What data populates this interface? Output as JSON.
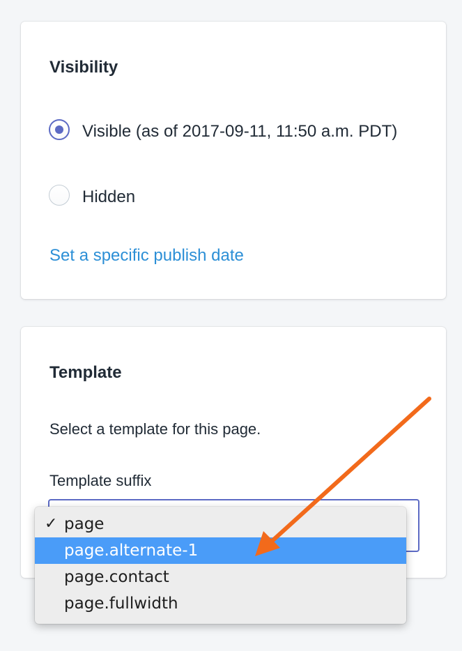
{
  "visibility": {
    "title": "Visibility",
    "options": [
      {
        "label": "Visible (as of 2017-09-11, 11:50 a.m. PDT)",
        "checked": true
      },
      {
        "label": "Hidden",
        "checked": false
      }
    ],
    "publish_link": "Set a specific publish date"
  },
  "template": {
    "title": "Template",
    "help": "Select a template for this page.",
    "suffix_label": "Template suffix",
    "options": [
      {
        "label": "page",
        "selected": true
      },
      {
        "label": "page.alternate-1",
        "highlighted": true
      },
      {
        "label": "page.contact"
      },
      {
        "label": "page.fullwidth"
      }
    ],
    "check_glyph": "✓"
  },
  "colors": {
    "accent": "#5c6ac4",
    "link": "#2c8fd6",
    "highlight": "#4a9cf8",
    "arrow": "#f26a1b"
  },
  "icons": {
    "checkmark": "checkmark-icon",
    "annotation_arrow": "arrow-icon"
  }
}
